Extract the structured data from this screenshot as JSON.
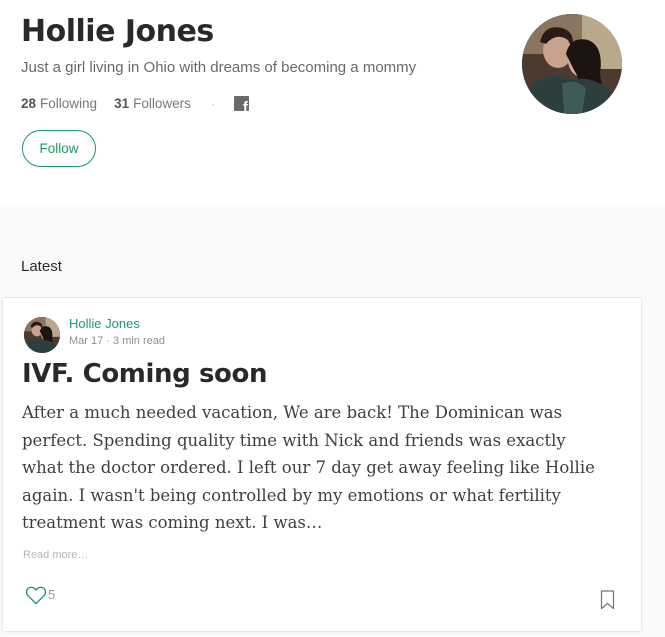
{
  "profile": {
    "name": "Hollie Jones",
    "bio": "Just a girl living in Ohio with dreams of becoming a mommy",
    "following_count": "28",
    "following_label": "Following",
    "followers_count": "31",
    "followers_label": "Followers",
    "separator": "·",
    "social_icon": "facebook-icon",
    "follow_label": "Follow"
  },
  "section": {
    "latest_label": "Latest"
  },
  "post": {
    "author": "Hollie Jones",
    "date": "Mar 17",
    "meta_sep": " · ",
    "read_time": "3 min read",
    "title": "IVF. Coming soon",
    "excerpt": "After a much needed vacation, We are back! The Dominican was perfect. Spending quality time with Nick and friends was exactly what the doctor ordered. I left our 7 day get away feeling like Hollie again. I wasn't being controlled by my emotions or what fertility treatment was coming next. I was…",
    "read_more": "Read more…",
    "likes": "5"
  },
  "colors": {
    "accent_green": "#1c9963",
    "background": "#fafafa",
    "card": "#ffffff"
  }
}
